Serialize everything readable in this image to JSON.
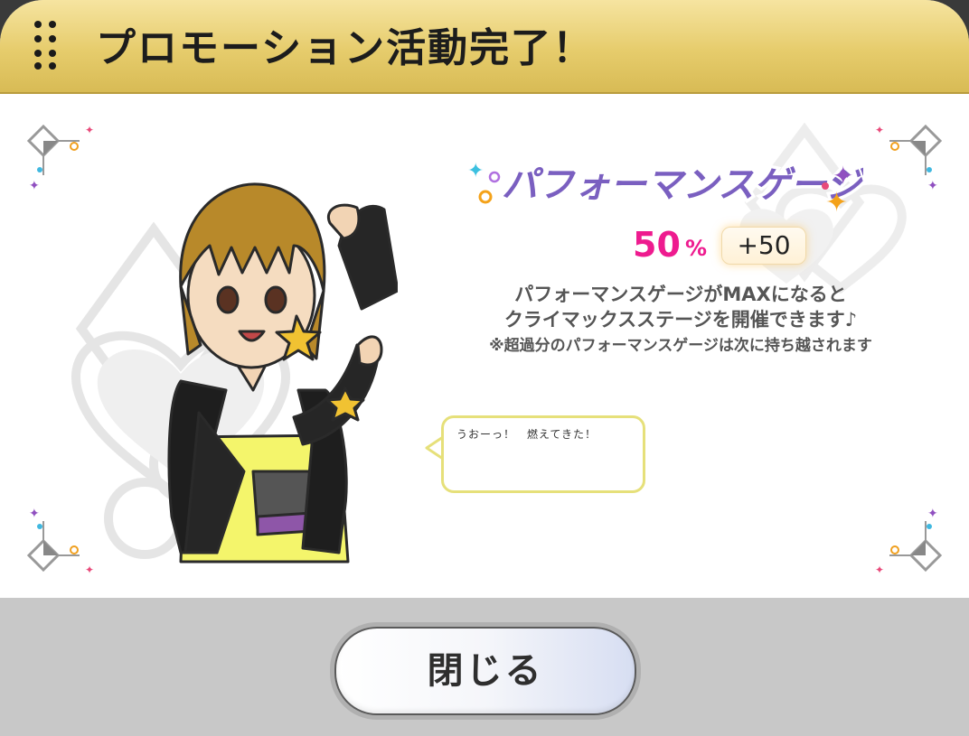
{
  "header": {
    "title": "プロモーション活動完了！"
  },
  "gauge": {
    "title": "パフォーマンスゲージ",
    "percent": "50",
    "percent_symbol": "%",
    "bonus": "+50",
    "description_line1": "パフォーマンスゲージがMAXになると",
    "description_line2": "クライマックスステージを開催できます♪",
    "note": "※超過分のパフォーマンスゲージは次に持ち越されます"
  },
  "speech": {
    "text": "うおーっ！　燃えてきた！"
  },
  "footer": {
    "close_label": "閉じる"
  },
  "colors": {
    "header_gold": "#e6cc6c",
    "percent_pink": "#ee1b8f",
    "gauge_title_purple": "#7a5fc0",
    "bubble_border": "#e6e07a"
  },
  "icons": [
    "grip-icon",
    "corner-ornament-icon",
    "suit-pattern-icon",
    "sparkle-icon"
  ]
}
